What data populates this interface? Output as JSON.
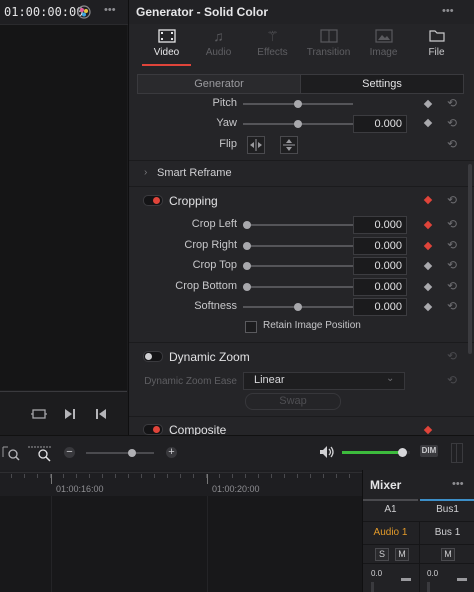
{
  "viewer": {
    "timecode": "01:00:00:00",
    "more_menu": "•••"
  },
  "inspector": {
    "title": "Generator - Solid Color",
    "more_menu": "•••",
    "tabs": [
      {
        "label": "Video",
        "icon": "film-icon",
        "active": true
      },
      {
        "label": "Audio",
        "icon": "music-note-icon",
        "active": false
      },
      {
        "label": "Effects",
        "icon": "magic-wand-icon",
        "active": false
      },
      {
        "label": "Transition",
        "icon": "transition-icon",
        "active": false
      },
      {
        "label": "Image",
        "icon": "image-icon",
        "active": false
      },
      {
        "label": "File",
        "icon": "file-icon",
        "active": false
      }
    ],
    "subtabs": [
      {
        "label": "Generator",
        "active": false
      },
      {
        "label": "Settings",
        "active": true
      }
    ],
    "transform": {
      "pitch_label": "Pitch",
      "pitch_value": 0.5,
      "yaw_label": "Yaw",
      "yaw_value": "0.000",
      "yaw_slider": 0.5,
      "flip_label": "Flip"
    },
    "smart_reframe": {
      "label": "Smart Reframe"
    },
    "cropping": {
      "label": "Cropping",
      "enabled": true,
      "rows": [
        {
          "label": "Crop Left",
          "value": "0.000",
          "slider": 0.0,
          "keyframe_color": "#e0443a"
        },
        {
          "label": "Crop Right",
          "value": "0.000",
          "slider": 0.0,
          "keyframe_color": "#e0443a"
        },
        {
          "label": "Crop Top",
          "value": "0.000",
          "slider": 0.0,
          "keyframe_color": "#a9a9ad"
        },
        {
          "label": "Crop Bottom",
          "value": "0.000",
          "slider": 0.0,
          "keyframe_color": "#a9a9ad"
        },
        {
          "label": "Softness",
          "value": "0.000",
          "slider": 0.5,
          "keyframe_color": "#a9a9ad"
        }
      ],
      "retain_label": "Retain Image Position"
    },
    "dynamic_zoom": {
      "label": "Dynamic Zoom",
      "enabled": false,
      "ease_label": "Dynamic Zoom Ease",
      "ease_value": "Linear",
      "swap_label": "Swap"
    },
    "composite": {
      "label": "Composite"
    }
  },
  "timeline": {
    "ruler_ticks": [
      "01:00:16:00",
      "01:00:20:00"
    ],
    "zoom_minus": "−",
    "zoom_plus": "+",
    "dim_label": "DIM",
    "volume_level": 0.88
  },
  "mixer": {
    "title": "Mixer",
    "more_menu": "•••",
    "channels": [
      "A1",
      "Bus1"
    ],
    "routes": [
      "Audio 1",
      "Bus 1"
    ],
    "solo_label": "S",
    "mute_label": "M",
    "levels": [
      "0.0",
      "0.0"
    ]
  },
  "colors": {
    "accent_red": "#e0443a",
    "active_tab_underline": "#e0443a",
    "volume_green": "#3dbb3d",
    "mixer_routing_orange": "#e29a2a"
  }
}
